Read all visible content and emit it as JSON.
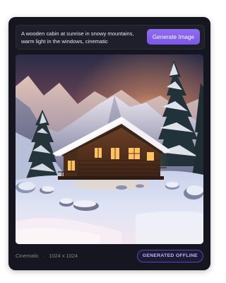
{
  "prompt": {
    "text": "A wooden cabin at sunrise in snowy mountains, warm light in the windows, cinematic"
  },
  "generate_button": {
    "label": "Generate Image",
    "color": "#7b58e6"
  },
  "image": {
    "alt": "Snowy mountain cabin at sunrise"
  },
  "footer": {
    "style": "Cinematic",
    "separator": "·",
    "resolution": "1024 x 1024",
    "badge": "GENERATED OFFLINE",
    "badge_color": "#5b46b8"
  }
}
